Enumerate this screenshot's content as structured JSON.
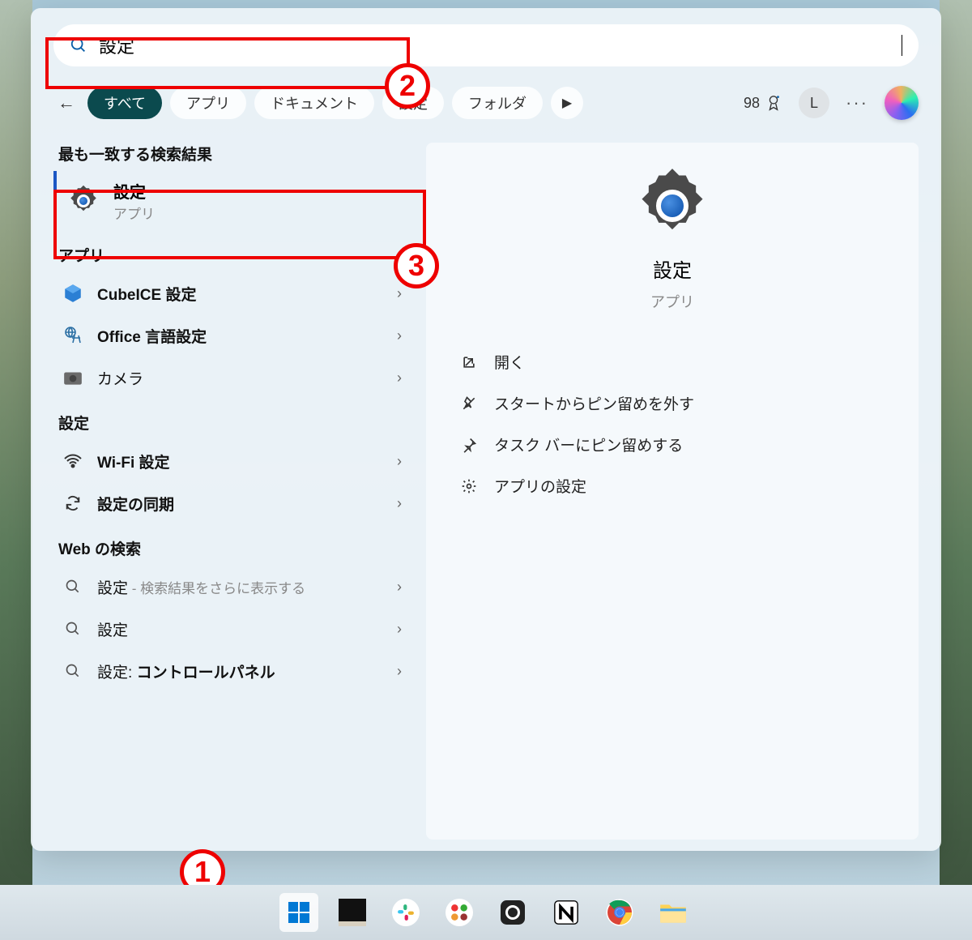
{
  "search": {
    "value": "設定"
  },
  "filters": {
    "all": "すべて",
    "apps": "アプリ",
    "documents": "ドキュメント",
    "settings": "設定",
    "folders": "フォルダ"
  },
  "rewards_count": "98",
  "user_initial": "L",
  "left": {
    "best_match_h": "最も一致する検索結果",
    "best": {
      "title": "設定",
      "sub": "アプリ"
    },
    "apps_h": "アプリ",
    "apps": [
      {
        "label": "CubeICE 設定"
      },
      {
        "label": "Office 言語設定"
      },
      {
        "label": "カメラ"
      }
    ],
    "settings_h": "設定",
    "settings": [
      {
        "label": "Wi-Fi 設定"
      },
      {
        "label": "設定の同期"
      }
    ],
    "web_h": "Web の検索",
    "web": [
      {
        "label": "設定",
        "sub": " - 検索結果をさらに表示する"
      },
      {
        "label": "設定"
      },
      {
        "label_prefix": "設定: ",
        "bold": "コントロールパネル"
      }
    ]
  },
  "detail": {
    "title": "設定",
    "sub": "アプリ",
    "actions": {
      "open": "開く",
      "unpin_start": "スタートからピン留めを外す",
      "pin_taskbar": "タスク バーにピン留めする",
      "app_settings": "アプリの設定"
    }
  },
  "callouts": {
    "c1": "1",
    "c2": "2",
    "c3": "3"
  }
}
